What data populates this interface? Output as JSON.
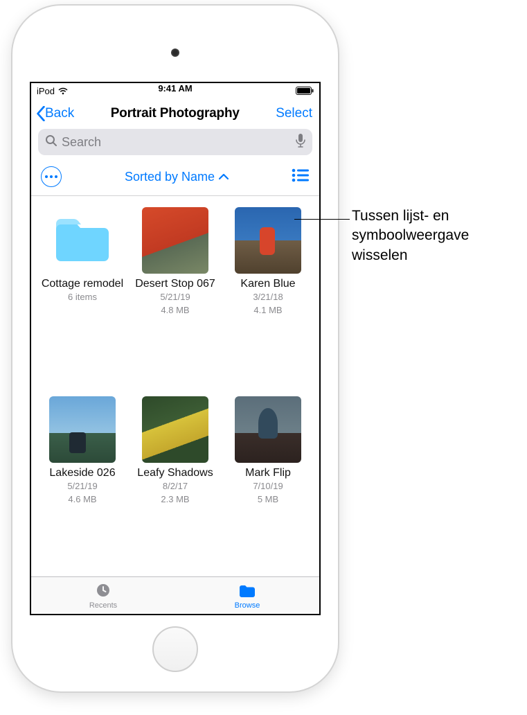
{
  "status": {
    "carrier": "iPod",
    "time": "9:41 AM"
  },
  "nav": {
    "back": "Back",
    "title": "Portrait Photography",
    "select": "Select"
  },
  "search": {
    "placeholder": "Search"
  },
  "sort_row": {
    "label": "Sorted by Name"
  },
  "items": [
    {
      "name": "Cottage remodel",
      "meta1": "6 items",
      "meta2": "",
      "kind": "folder"
    },
    {
      "name": "Desert Stop 067",
      "meta1": "5/21/19",
      "meta2": "4.8 MB",
      "kind": "image"
    },
    {
      "name": "Karen Blue",
      "meta1": "3/21/18",
      "meta2": "4.1 MB",
      "kind": "image"
    },
    {
      "name": "Lakeside 026",
      "meta1": "5/21/19",
      "meta2": "4.6 MB",
      "kind": "image"
    },
    {
      "name": "Leafy Shadows",
      "meta1": "8/2/17",
      "meta2": "2.3 MB",
      "kind": "image"
    },
    {
      "name": "Mark Flip",
      "meta1": "7/10/19",
      "meta2": "5 MB",
      "kind": "image"
    }
  ],
  "tabs": {
    "recents": "Recents",
    "browse": "Browse"
  },
  "callout": "Tussen lijst- en symboolweergave wisselen"
}
